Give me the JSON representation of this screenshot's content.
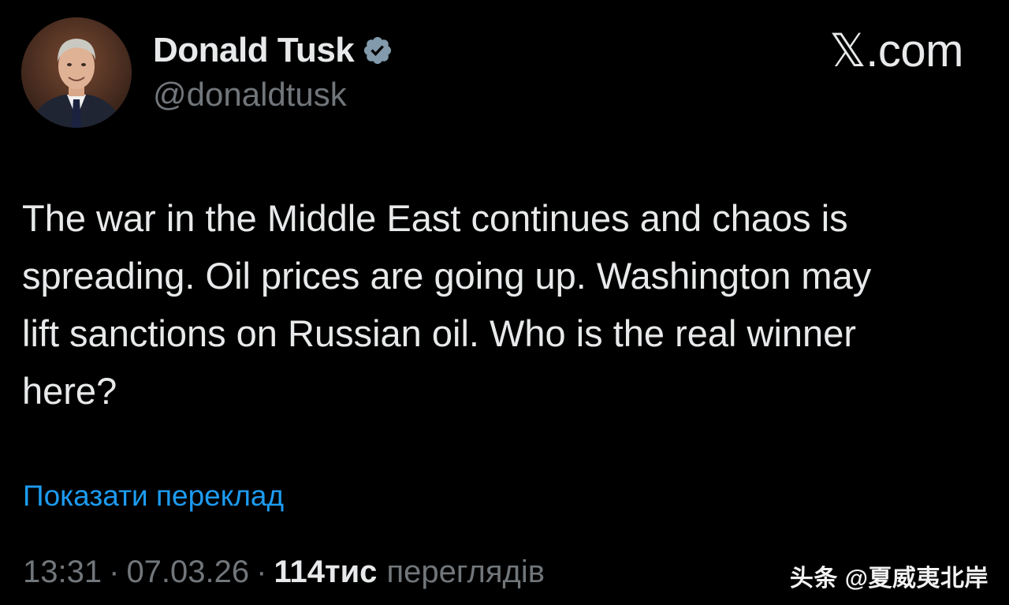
{
  "header": {
    "display_name": "Donald Tusk",
    "handle": "@donaldtusk",
    "brand": "𝕏.com",
    "verified_icon": "verified-badge-icon",
    "avatar_icon": "profile-photo"
  },
  "tweet": {
    "text": "The war in the Middle East continues and chaos is\nspreading. Oil prices are going up. Washington may\nlift sanctions on Russian oil. Who is the real winner\nhere?",
    "translate_label": "Показати переклад"
  },
  "meta": {
    "time": "13:31",
    "separator": "·",
    "date": "07.03.26",
    "views_count": "114тис",
    "views_label": "переглядів"
  },
  "watermark": {
    "text": "头条 @夏威夷北岸"
  },
  "colors": {
    "background": "#000000",
    "text_primary": "#e7e9ea",
    "text_secondary": "#71767b",
    "link": "#1d9bf0",
    "verified_badge": "#829aab"
  }
}
